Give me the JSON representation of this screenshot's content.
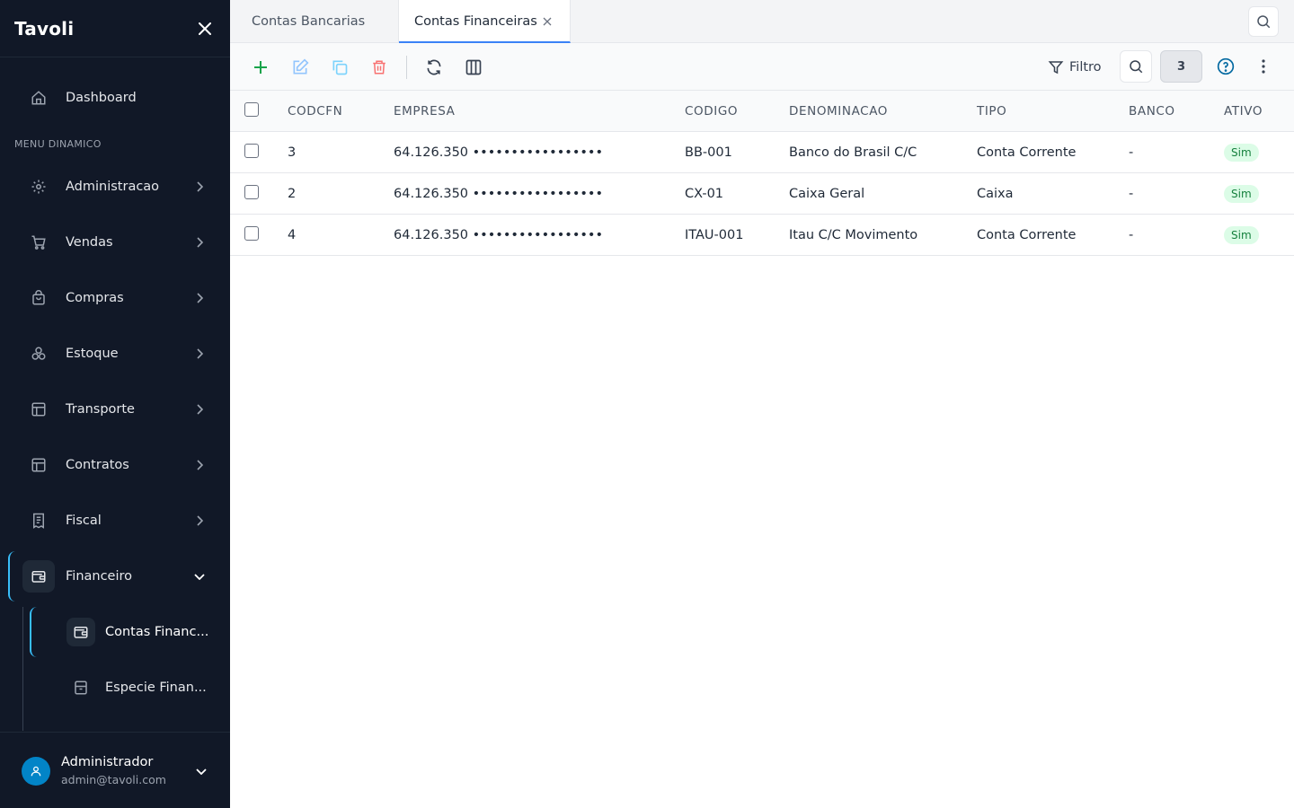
{
  "sidebar": {
    "brand": "Tavoli",
    "dashboard": "Dashboard",
    "section_label": "MENU DINAMICO",
    "items": [
      {
        "label": "Administracao",
        "icon": "gear-icon"
      },
      {
        "label": "Vendas",
        "icon": "cart-icon"
      },
      {
        "label": "Compras",
        "icon": "bag-icon"
      },
      {
        "label": "Estoque",
        "icon": "boxes-icon"
      },
      {
        "label": "Transporte",
        "icon": "layout-icon"
      },
      {
        "label": "Contratos",
        "icon": "layout-icon"
      },
      {
        "label": "Fiscal",
        "icon": "receipt-icon"
      },
      {
        "label": "Financeiro",
        "icon": "wallet-icon"
      }
    ],
    "subitems": [
      {
        "label": "Contas Financ...",
        "icon": "wallet-icon"
      },
      {
        "label": "Especie Finan...",
        "icon": "archive-icon"
      }
    ],
    "user": {
      "name": "Administrador",
      "email": "admin@tavoli.com"
    }
  },
  "tabs": [
    {
      "label": "Contas Bancarias"
    },
    {
      "label": "Contas Financeiras"
    }
  ],
  "toolbar": {
    "filter_label": "Filtro",
    "record_count": "3"
  },
  "table": {
    "columns": [
      "CODCFN",
      "EMPRESA",
      "CODIGO",
      "DENOMINACAO",
      "TIPO",
      "BANCO",
      "ATIVO"
    ],
    "rows": [
      {
        "codcfn": "3",
        "empresa": "64.126.350 •••••••••••••••••",
        "codigo": "BB-001",
        "denominacao": "Banco do Brasil C/C",
        "tipo": "Conta Corrente",
        "banco": "-",
        "ativo": "Sim"
      },
      {
        "codcfn": "2",
        "empresa": "64.126.350 •••••••••••••••••",
        "codigo": "CX-01",
        "denominacao": "Caixa Geral",
        "tipo": "Caixa",
        "banco": "-",
        "ativo": "Sim"
      },
      {
        "codcfn": "4",
        "empresa": "64.126.350 •••••••••••••••••",
        "codigo": "ITAU-001",
        "denominacao": "Itau C/C Movimento",
        "tipo": "Conta Corrente",
        "banco": "-",
        "ativo": "Sim"
      }
    ]
  },
  "colors": {
    "sidebar_bg": "#111827",
    "accent": "#38bdf8",
    "tab_active": "#3b82f6",
    "add_green": "#16a34a",
    "delete_red": "#ef4444",
    "status_green_bg": "#dcfce7",
    "status_green_text": "#15803d"
  }
}
